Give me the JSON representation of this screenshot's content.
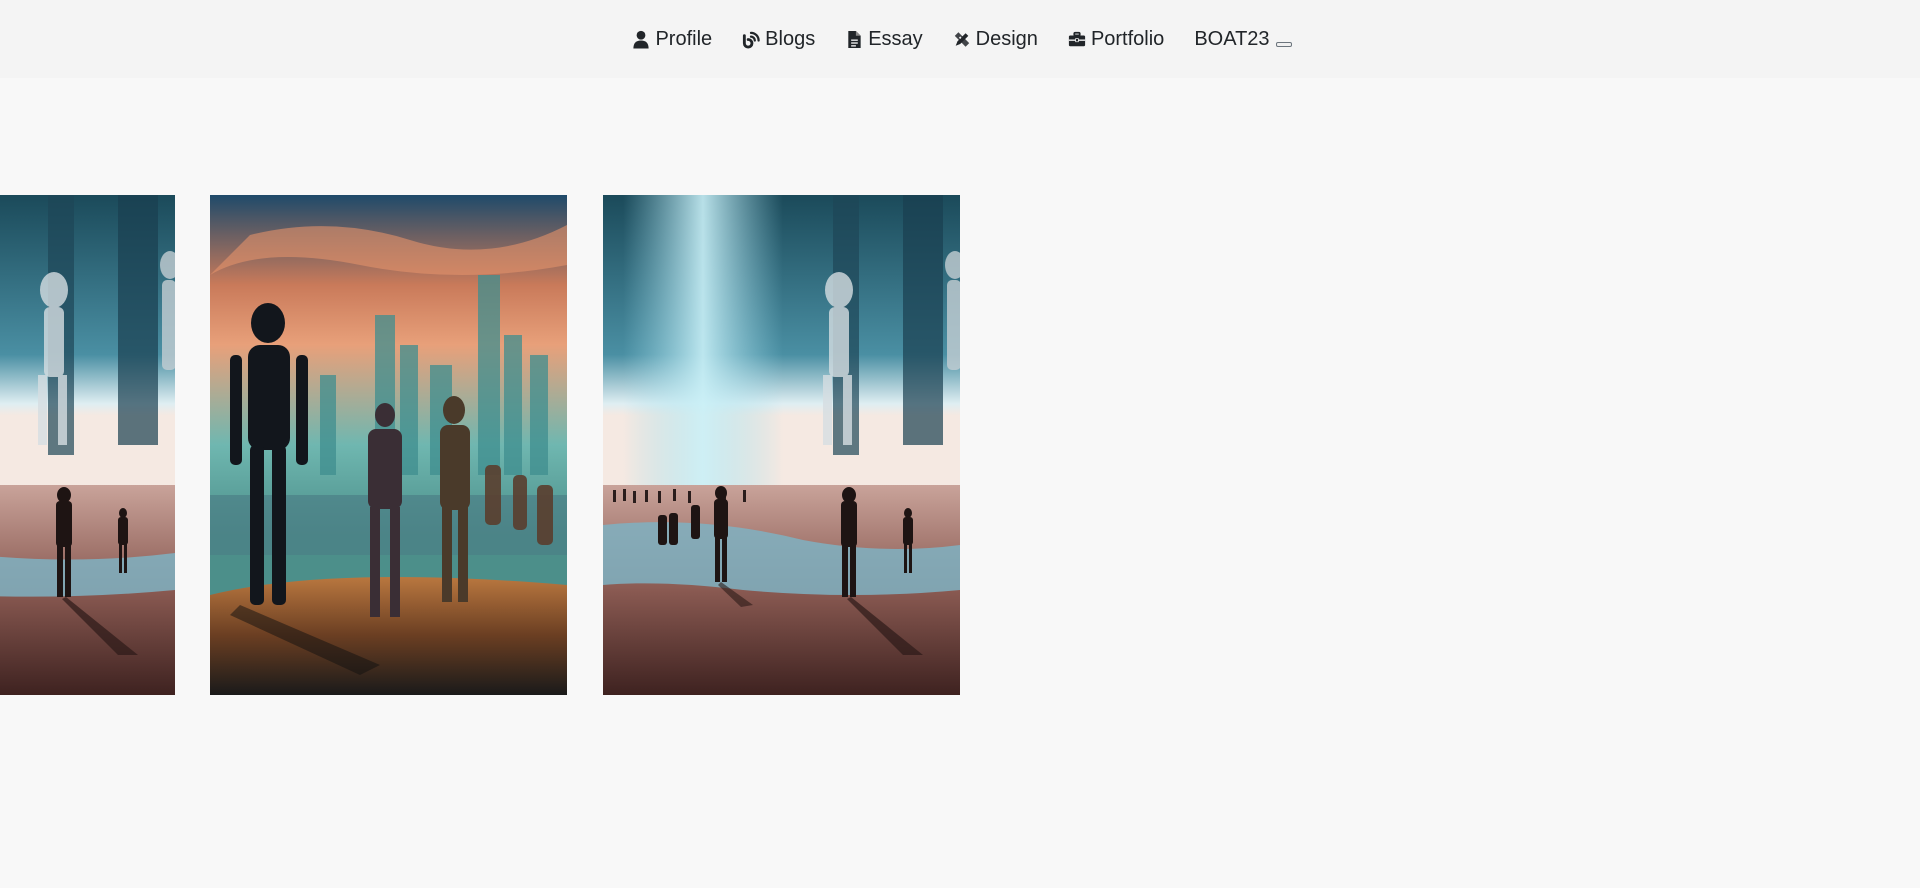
{
  "nav": {
    "items": [
      {
        "label": "Profile",
        "icon": "user-icon"
      },
      {
        "label": "Blogs",
        "icon": "blog-icon"
      },
      {
        "label": "Essay",
        "icon": "document-icon"
      },
      {
        "label": "Design",
        "icon": "design-tools-icon"
      },
      {
        "label": "Portfolio",
        "icon": "briefcase-icon"
      }
    ],
    "brand": "BOAT23"
  },
  "carousel": {
    "slides": [
      {
        "image": "beach-silhouettes-skeleton-giant"
      },
      {
        "image": "skeleton-robots-city-sunset"
      },
      {
        "image": "beach-silhouettes-skeleton-giant"
      }
    ]
  },
  "colors": {
    "page_bg": "#f8f8f8",
    "nav_bg": "#f4f4f4",
    "text": "#212529"
  }
}
